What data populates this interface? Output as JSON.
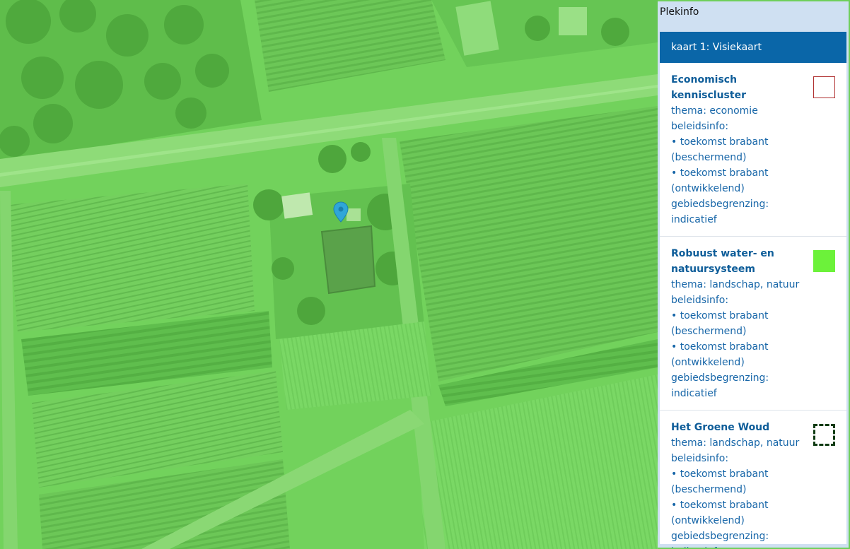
{
  "panel": {
    "title": "Plekinfo",
    "map_title": "kaart 1: Visiekaart",
    "items": [
      {
        "title": "Economisch kenniscluster",
        "thema": "thema: economie",
        "beleidsinfo": "beleidsinfo:",
        "bullet1": "• toekomst brabant (beschermend)",
        "bullet2": "• toekomst brabant (ontwikkelend)",
        "gebied": "gebiedsbegrenzing: indicatief",
        "swatch": {
          "style": "outline",
          "color": "#b03030"
        }
      },
      {
        "title": "Robuust water- en natuursysteem",
        "thema": "thema: landschap, natuur",
        "beleidsinfo": "beleidsinfo:",
        "bullet1": "• toekomst brabant (beschermend)",
        "bullet2": "• toekomst brabant (ontwikkelend)",
        "gebied": "gebiedsbegrenzing: indicatief",
        "swatch": {
          "style": "fill",
          "color": "#6cf23a"
        }
      },
      {
        "title": "Het Groene Woud",
        "thema": "thema: landschap, natuur",
        "beleidsinfo": "beleidsinfo:",
        "bullet1": "• toekomst brabant (beschermend)",
        "bullet2": "• toekomst brabant (ontwikkelend)",
        "gebied": "gebiedsbegrenzing: indicatief",
        "swatch": {
          "style": "dashed",
          "color": "#0f3a12"
        }
      }
    ]
  },
  "map": {
    "overlay_color": "#6fcf5a",
    "marker": "location-pin-icon",
    "marker_color": "#2fa6d8"
  }
}
